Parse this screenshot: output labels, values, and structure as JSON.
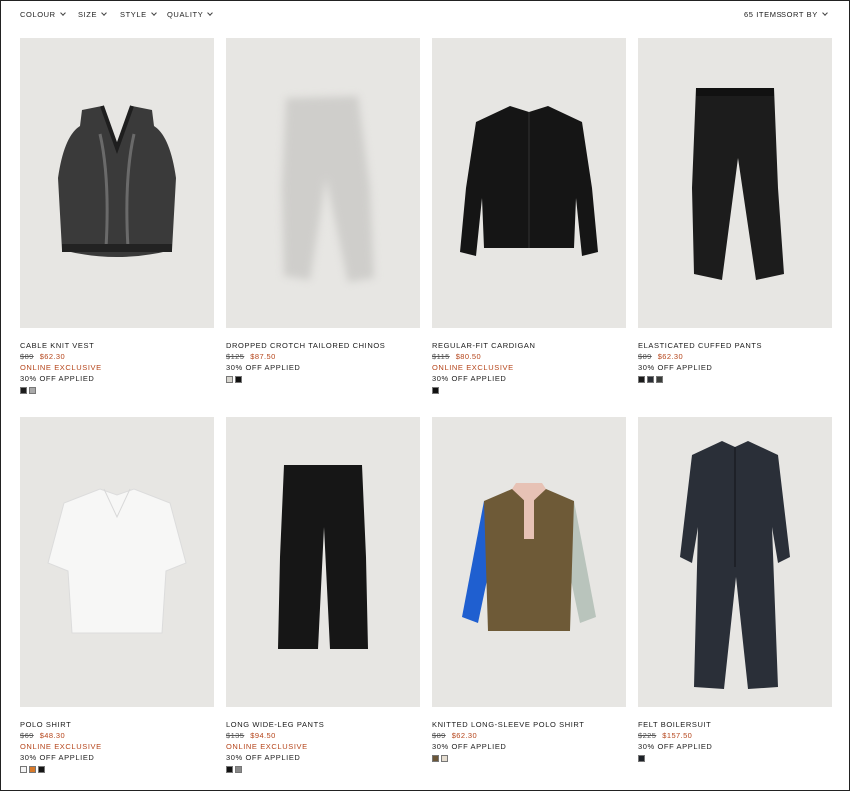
{
  "toolbar": {
    "filters": [
      "COLOUR",
      "SIZE",
      "STYLE",
      "QUALITY"
    ],
    "items_count": "65 ITEMS",
    "sort_label": "SORT BY"
  },
  "products": [
    {
      "name": "CABLE KNIT VEST",
      "old_price": "$89",
      "new_price": "$62.30",
      "exclusive": "ONLINE EXCLUSIVE",
      "discount": "30% OFF APPLIED",
      "swatches": [
        "#1c1c1c",
        "#a9a9a9"
      ]
    },
    {
      "name": "DROPPED CROTCH TAILORED CHINOS",
      "old_price": "$125",
      "new_price": "$87.50",
      "exclusive": "",
      "discount": "30% OFF APPLIED",
      "swatches": [
        "#d8d6cf",
        "#111111"
      ]
    },
    {
      "name": "REGULAR-FIT CARDIGAN",
      "old_price": "$115",
      "new_price": "$80.50",
      "exclusive": "ONLINE EXCLUSIVE",
      "discount": "30% OFF APPLIED",
      "swatches": [
        "#111111"
      ]
    },
    {
      "name": "ELASTICATED CUFFED PANTS",
      "old_price": "$89",
      "new_price": "$62.30",
      "exclusive": "",
      "discount": "30% OFF APPLIED",
      "swatches": [
        "#1a1a1a",
        "#2a2d33",
        "#3a3d3a"
      ]
    },
    {
      "name": "POLO SHIRT",
      "old_price": "$69",
      "new_price": "$48.30",
      "exclusive": "ONLINE EXCLUSIVE",
      "discount": "30% OFF APPLIED",
      "swatches": [
        "#f4f4f4",
        "#d97a2a",
        "#151515"
      ]
    },
    {
      "name": "LONG WIDE-LEG PANTS",
      "old_price": "$135",
      "new_price": "$94.50",
      "exclusive": "ONLINE EXCLUSIVE",
      "discount": "30% OFF APPLIED",
      "swatches": [
        "#111111",
        "#8a8a8a"
      ]
    },
    {
      "name": "KNITTED LONG-SLEEVE POLO SHIRT",
      "old_price": "$89",
      "new_price": "$62.30",
      "exclusive": "",
      "discount": "30% OFF APPLIED",
      "swatches": [
        "#6b5638",
        "#e5ddd0"
      ]
    },
    {
      "name": "FELT BOILERSUIT",
      "old_price": "$225",
      "new_price": "$157.50",
      "exclusive": "",
      "discount": "30% OFF APPLIED",
      "swatches": [
        "#1d2127"
      ]
    }
  ]
}
